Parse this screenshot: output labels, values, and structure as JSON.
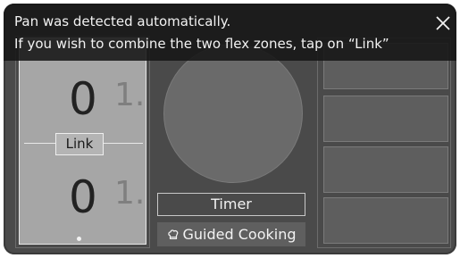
{
  "notification": {
    "line1": "Pan was detected automatically.",
    "line2": "If you wish to combine the two flex zones, tap on “Link”",
    "close_icon": "close-icon"
  },
  "flex_zone": {
    "front": {
      "level": "0",
      "next_level_hint": "1."
    },
    "rear": {
      "level": "0",
      "next_level_hint": "1."
    },
    "link_label": "Link"
  },
  "controls": {
    "timer_label": "Timer",
    "guided_cooking_label": "Guided Cooking",
    "guided_cooking_icon": "chef-hat-icon"
  },
  "colors": {
    "panel_bg": "#4a4a4a",
    "flex_zone_bg": "#a6a6a6",
    "toast_bg": "#161616"
  }
}
